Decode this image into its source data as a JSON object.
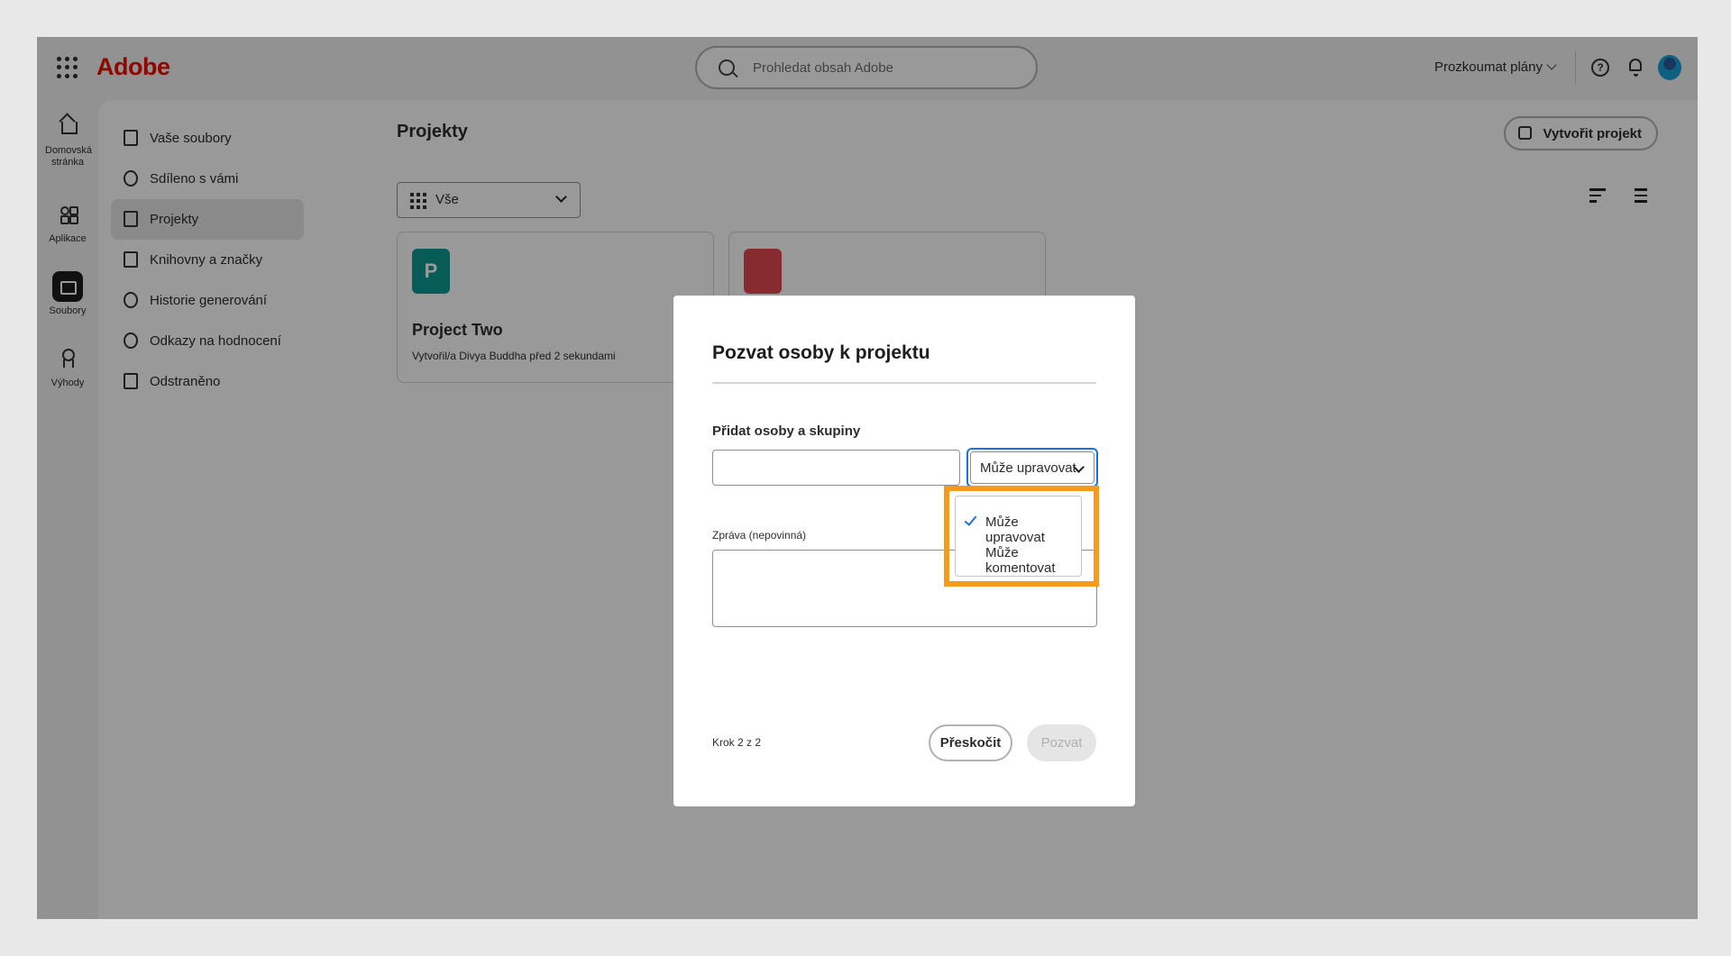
{
  "topbar": {
    "logo": "Adobe",
    "search_placeholder": "Prohledat obsah Adobe",
    "explore_label": "Prozkoumat plány",
    "help_glyph": "?"
  },
  "rail": [
    {
      "label": "Domovská stránka",
      "icon": "home-icon"
    },
    {
      "label": "Aplikace",
      "icon": "apps-icon"
    },
    {
      "label": "Soubory",
      "icon": "folder-icon"
    },
    {
      "label": "Výhody",
      "icon": "award-icon"
    }
  ],
  "nav": [
    {
      "label": "Vaše soubory",
      "icon": "file-icon",
      "active": false
    },
    {
      "label": "Sdíleno s vámi",
      "icon": "people-icon",
      "active": false
    },
    {
      "label": "Projekty",
      "icon": "project-icon",
      "active": true
    },
    {
      "label": "Knihovny a značky",
      "icon": "library-icon",
      "active": false
    },
    {
      "label": "Historie generování",
      "icon": "history-icon",
      "active": false
    },
    {
      "label": "Odkazy na hodnocení",
      "icon": "link-icon",
      "active": false
    },
    {
      "label": "Odstraněno",
      "icon": "trash-icon",
      "active": false
    }
  ],
  "main": {
    "title": "Projekty",
    "create_button": "Vytvořit projekt",
    "filter_value": "Vše",
    "cards": [
      {
        "badge": "P",
        "title": "Project Two",
        "subtitle": "Vytvořil/a Divya Buddha před 2 sekundami"
      },
      {
        "badge": "",
        "title": "",
        "subtitle": ""
      }
    ]
  },
  "dialog": {
    "title": "Pozvat osoby k projektu",
    "add_label": "Přidat osoby a skupiny",
    "add_value": "",
    "permission_value": "Může upravovat",
    "message_label": "Zpráva (nepovinná)",
    "message_value": "",
    "step": "Krok 2 z 2",
    "skip_button": "Přeskočit",
    "invite_button": "Pozvat"
  },
  "dropdown": {
    "options": [
      {
        "label": "Může upravovat",
        "selected": true
      },
      {
        "label": "Může komentovat",
        "selected": false
      }
    ]
  },
  "colors": {
    "brand": "#eb1000",
    "focus": "#1473e6",
    "highlight": "#f59a1b",
    "badge": "#0e9a92"
  }
}
